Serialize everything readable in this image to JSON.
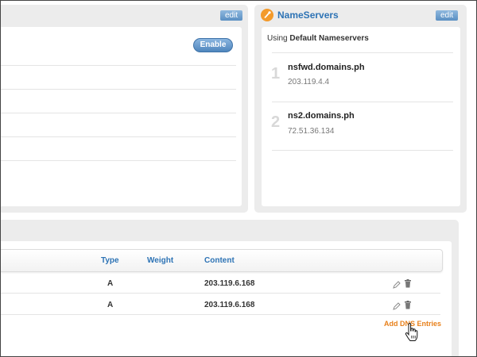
{
  "left_panel": {
    "edit_label": "edit",
    "enable_label": "Enable"
  },
  "nameservers": {
    "title": "NameServers",
    "edit_label": "edit",
    "using_prefix": "Using",
    "using_value": "Default Nameservers",
    "entries": [
      {
        "index": "1",
        "host": "nsfwd.domains.ph",
        "ip": "203.119.4.4"
      },
      {
        "index": "2",
        "host": "ns2.domains.ph",
        "ip": "72.51.36.134"
      }
    ]
  },
  "dns_table": {
    "columns": [
      "Type",
      "Weight",
      "Content"
    ],
    "rows": [
      {
        "type": "A",
        "weight": "",
        "content": "203.119.6.168"
      },
      {
        "type": "A",
        "weight": "",
        "content": "203.119.6.168"
      }
    ],
    "add_label": "Add DNS Entries"
  },
  "icons": {
    "nameservers": "wrench-icon",
    "row_edit": "pencil-icon",
    "row_delete": "trash-icon",
    "cursor": "hand-pointer-icon"
  },
  "colors": {
    "link_blue": "#2d73b5",
    "accent_orange": "#e8801a",
    "panel_gray": "#ececec"
  }
}
